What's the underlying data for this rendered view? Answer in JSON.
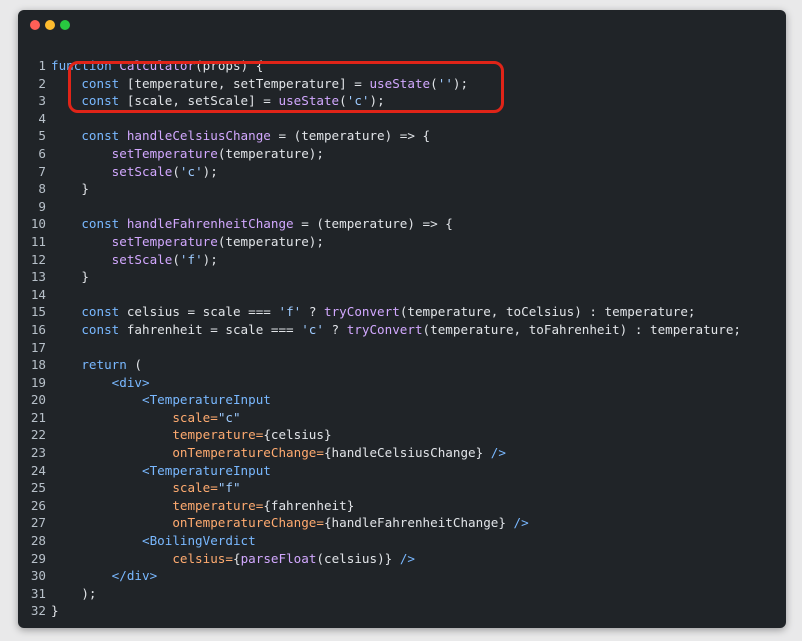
{
  "window": {
    "controls": [
      "close",
      "minimize",
      "maximize"
    ]
  },
  "code": {
    "lines": [
      {
        "num": "1",
        "segments": [
          {
            "t": "function ",
            "c": "kw"
          },
          {
            "t": "Calculator",
            "c": "fn"
          },
          {
            "t": "(props) {",
            "c": "var"
          }
        ]
      },
      {
        "num": "2",
        "segments": [
          {
            "t": "    const ",
            "c": "kw"
          },
          {
            "t": "[temperature, setTemperature] = ",
            "c": "var"
          },
          {
            "t": "useState",
            "c": "fn"
          },
          {
            "t": "(",
            "c": "var"
          },
          {
            "t": "''",
            "c": "str"
          },
          {
            "t": ");",
            "c": "var"
          }
        ]
      },
      {
        "num": "3",
        "segments": [
          {
            "t": "    const ",
            "c": "kw"
          },
          {
            "t": "[scale, setScale] = ",
            "c": "var"
          },
          {
            "t": "useState",
            "c": "fn"
          },
          {
            "t": "(",
            "c": "var"
          },
          {
            "t": "'c'",
            "c": "str"
          },
          {
            "t": ");",
            "c": "var"
          }
        ]
      },
      {
        "num": "4",
        "segments": []
      },
      {
        "num": "5",
        "segments": [
          {
            "t": "    const ",
            "c": "kw"
          },
          {
            "t": "handleCelsiusChange",
            "c": "fn"
          },
          {
            "t": " = (temperature) => {",
            "c": "var"
          }
        ]
      },
      {
        "num": "6",
        "segments": [
          {
            "t": "        setTemperature",
            "c": "fn"
          },
          {
            "t": "(temperature);",
            "c": "var"
          }
        ]
      },
      {
        "num": "7",
        "segments": [
          {
            "t": "        setScale",
            "c": "fn"
          },
          {
            "t": "(",
            "c": "var"
          },
          {
            "t": "'c'",
            "c": "str"
          },
          {
            "t": ");",
            "c": "var"
          }
        ]
      },
      {
        "num": "8",
        "segments": [
          {
            "t": "    }",
            "c": "var"
          }
        ]
      },
      {
        "num": "9",
        "segments": []
      },
      {
        "num": "10",
        "segments": [
          {
            "t": "    const ",
            "c": "kw"
          },
          {
            "t": "handleFahrenheitChange",
            "c": "fn"
          },
          {
            "t": " = (temperature) => {",
            "c": "var"
          }
        ]
      },
      {
        "num": "11",
        "segments": [
          {
            "t": "        setTemperature",
            "c": "fn"
          },
          {
            "t": "(temperature);",
            "c": "var"
          }
        ]
      },
      {
        "num": "12",
        "segments": [
          {
            "t": "        setScale",
            "c": "fn"
          },
          {
            "t": "(",
            "c": "var"
          },
          {
            "t": "'f'",
            "c": "str"
          },
          {
            "t": ");",
            "c": "var"
          }
        ]
      },
      {
        "num": "13",
        "segments": [
          {
            "t": "    }",
            "c": "var"
          }
        ]
      },
      {
        "num": "14",
        "segments": []
      },
      {
        "num": "15",
        "segments": [
          {
            "t": "    const ",
            "c": "kw"
          },
          {
            "t": "celsius = scale === ",
            "c": "var"
          },
          {
            "t": "'f'",
            "c": "str"
          },
          {
            "t": " ? ",
            "c": "var"
          },
          {
            "t": "tryConvert",
            "c": "fn"
          },
          {
            "t": "(temperature, toCelsius) : temperature;",
            "c": "var"
          }
        ]
      },
      {
        "num": "16",
        "segments": [
          {
            "t": "    const ",
            "c": "kw"
          },
          {
            "t": "fahrenheit = scale === ",
            "c": "var"
          },
          {
            "t": "'c'",
            "c": "str"
          },
          {
            "t": " ? ",
            "c": "var"
          },
          {
            "t": "tryConvert",
            "c": "fn"
          },
          {
            "t": "(temperature, toFahrenheit) : temperature;",
            "c": "var"
          }
        ]
      },
      {
        "num": "17",
        "segments": []
      },
      {
        "num": "18",
        "segments": [
          {
            "t": "    return ",
            "c": "kw"
          },
          {
            "t": "(",
            "c": "var"
          }
        ]
      },
      {
        "num": "19",
        "segments": [
          {
            "t": "        <div>",
            "c": "jsx"
          }
        ]
      },
      {
        "num": "20",
        "segments": [
          {
            "t": "            <TemperatureInput",
            "c": "jsx"
          }
        ]
      },
      {
        "num": "21",
        "segments": [
          {
            "t": "                scale=",
            "c": "attr"
          },
          {
            "t": "\"c\"",
            "c": "str"
          }
        ]
      },
      {
        "num": "22",
        "segments": [
          {
            "t": "                temperature=",
            "c": "attr"
          },
          {
            "t": "{celsius}",
            "c": "var"
          }
        ]
      },
      {
        "num": "23",
        "segments": [
          {
            "t": "                onTemperatureChange=",
            "c": "attr"
          },
          {
            "t": "{handleCelsiusChange}",
            "c": "var"
          },
          {
            "t": " />",
            "c": "jsx"
          }
        ]
      },
      {
        "num": "24",
        "segments": [
          {
            "t": "            <TemperatureInput",
            "c": "jsx"
          }
        ]
      },
      {
        "num": "25",
        "segments": [
          {
            "t": "                scale=",
            "c": "attr"
          },
          {
            "t": "\"f\"",
            "c": "str"
          }
        ]
      },
      {
        "num": "26",
        "segments": [
          {
            "t": "                temperature=",
            "c": "attr"
          },
          {
            "t": "{fahrenheit}",
            "c": "var"
          }
        ]
      },
      {
        "num": "27",
        "segments": [
          {
            "t": "                onTemperatureChange=",
            "c": "attr"
          },
          {
            "t": "{handleFahrenheitChange}",
            "c": "var"
          },
          {
            "t": " />",
            "c": "jsx"
          }
        ]
      },
      {
        "num": "28",
        "segments": [
          {
            "t": "            <BoilingVerdict",
            "c": "jsx"
          }
        ]
      },
      {
        "num": "29",
        "segments": [
          {
            "t": "                celsius=",
            "c": "attr"
          },
          {
            "t": "{",
            "c": "var"
          },
          {
            "t": "parseFloat",
            "c": "fn"
          },
          {
            "t": "(celsius)}",
            "c": "var"
          },
          {
            "t": " />",
            "c": "jsx"
          }
        ]
      },
      {
        "num": "30",
        "segments": [
          {
            "t": "        </div>",
            "c": "jsx"
          }
        ]
      },
      {
        "num": "31",
        "segments": [
          {
            "t": "    );",
            "c": "var"
          }
        ]
      },
      {
        "num": "32",
        "segments": [
          {
            "t": "}",
            "c": "var"
          }
        ]
      }
    ]
  },
  "annotation": {
    "highlight_color": "#e02418",
    "highlighted_lines": [
      "2",
      "3"
    ]
  }
}
